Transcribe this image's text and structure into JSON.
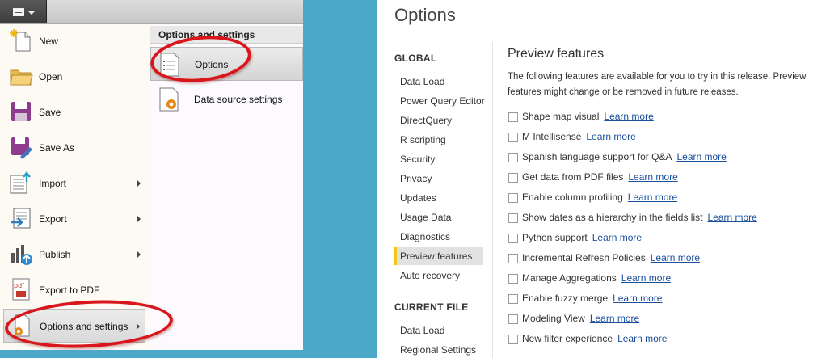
{
  "file_menu": {
    "items": [
      {
        "label": "New",
        "icon": "new-file-icon"
      },
      {
        "label": "Open",
        "icon": "folder-icon"
      },
      {
        "label": "Save",
        "icon": "save-icon"
      },
      {
        "label": "Save As",
        "icon": "save-as-icon"
      },
      {
        "label": "Import",
        "icon": "import-icon"
      },
      {
        "label": "Export",
        "icon": "export-icon"
      },
      {
        "label": "Publish",
        "icon": "publish-icon"
      },
      {
        "label": "Export to PDF",
        "icon": "pdf-icon"
      },
      {
        "label": "Options and settings",
        "icon": "options-settings-icon"
      }
    ],
    "submenu": {
      "header": "Options and settings",
      "items": [
        {
          "label": "Options",
          "icon": "options-page-icon"
        },
        {
          "label": "Data source settings",
          "icon": "data-source-settings-icon"
        }
      ]
    }
  },
  "options": {
    "title": "Options",
    "nav": {
      "global_heading": "GLOBAL",
      "global_items": [
        "Data Load",
        "Power Query Editor",
        "DirectQuery",
        "R scripting",
        "Security",
        "Privacy",
        "Updates",
        "Usage Data",
        "Diagnostics",
        "Preview features",
        "Auto recovery"
      ],
      "selected": "Preview features",
      "current_file_heading": "CURRENT FILE",
      "current_file_items": [
        "Data Load",
        "Regional Settings"
      ]
    },
    "preview": {
      "title": "Preview features",
      "description": "The following features are available for you to try in this release. Preview features might change or be removed in future releases.",
      "link_text": "Learn more",
      "features": [
        {
          "label": "Shape map visual",
          "checked": false
        },
        {
          "label": "M Intellisense",
          "checked": false
        },
        {
          "label": "Spanish language support for Q&A",
          "checked": false
        },
        {
          "label": "Get data from PDF files",
          "checked": false
        },
        {
          "label": "Enable column profiling",
          "checked": false
        },
        {
          "label": "Show dates as a hierarchy in the fields list",
          "checked": false
        },
        {
          "label": "Python support",
          "checked": false
        },
        {
          "label": "Incremental Refresh Policies",
          "checked": false
        },
        {
          "label": "Manage Aggregations",
          "checked": false
        },
        {
          "label": "Enable fuzzy merge",
          "checked": false
        },
        {
          "label": "Modeling View",
          "checked": false
        },
        {
          "label": "New filter experience",
          "checked": false
        }
      ]
    }
  },
  "colors": {
    "background": "#4ba8c8",
    "highlight_ring": "#d9161b",
    "link": "#1a4f9c",
    "nav_selected_accent": "#f2c811"
  }
}
